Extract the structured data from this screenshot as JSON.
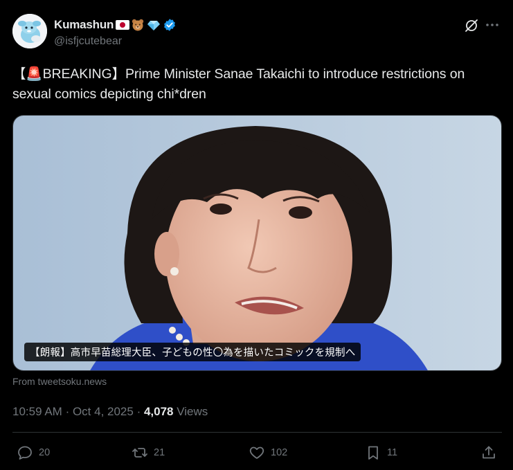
{
  "author": {
    "display_name": "Kumashun",
    "badges": [
      "japan-flag-icon",
      "bear-emoji",
      "gem-emoji",
      "verified-icon"
    ],
    "handle": "@isfjcutebear"
  },
  "tweet": {
    "text": "【🚨BREAKING】Prime Minister Sanae Takaichi to introduce restrictions on sexual comics depicting chi*dren",
    "image_caption": "【朗報】高市早苗総理大臣、子どもの性〇為を描いたコミックを規制へ",
    "source": "From tweetsoku.news"
  },
  "meta": {
    "time": "10:59 AM",
    "date": "Oct 4, 2025",
    "views_count": "4,078",
    "views_label": "Views"
  },
  "actions": {
    "replies": "20",
    "reposts": "21",
    "likes": "102",
    "bookmarks": "11"
  },
  "colors": {
    "background": "#000000",
    "text": "#e7e9ea",
    "muted": "#71767b",
    "verified": "#1d9bf0",
    "divider": "#2f3336"
  }
}
